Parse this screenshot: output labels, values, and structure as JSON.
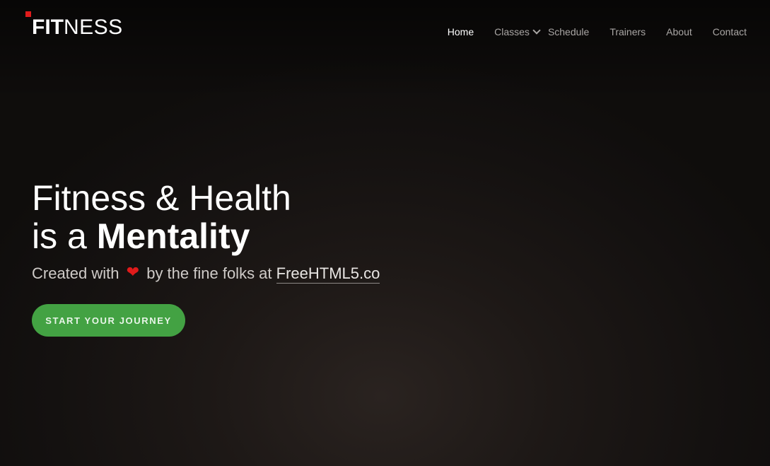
{
  "brand": {
    "logo_bold": "FIT",
    "logo_light": "NESS",
    "accent_color": "#e01b1b"
  },
  "nav": {
    "items": [
      {
        "label": "Home",
        "active": true
      },
      {
        "label": "Classes",
        "has_dropdown": true
      },
      {
        "label": "Schedule"
      },
      {
        "label": "Trainers"
      },
      {
        "label": "About"
      },
      {
        "label": "Contact"
      }
    ]
  },
  "hero": {
    "line1": "Fitness & Health",
    "line2_prefix": "is a ",
    "line2_bold": "Mentality",
    "sub_prefix": "Created with",
    "heart_icon": "heart-icon",
    "sub_middle": "by the fine folks at",
    "sub_link": "FreeHTML5.co",
    "cta_label": "START YOUR JOURNEY",
    "cta_color": "#43a243"
  }
}
